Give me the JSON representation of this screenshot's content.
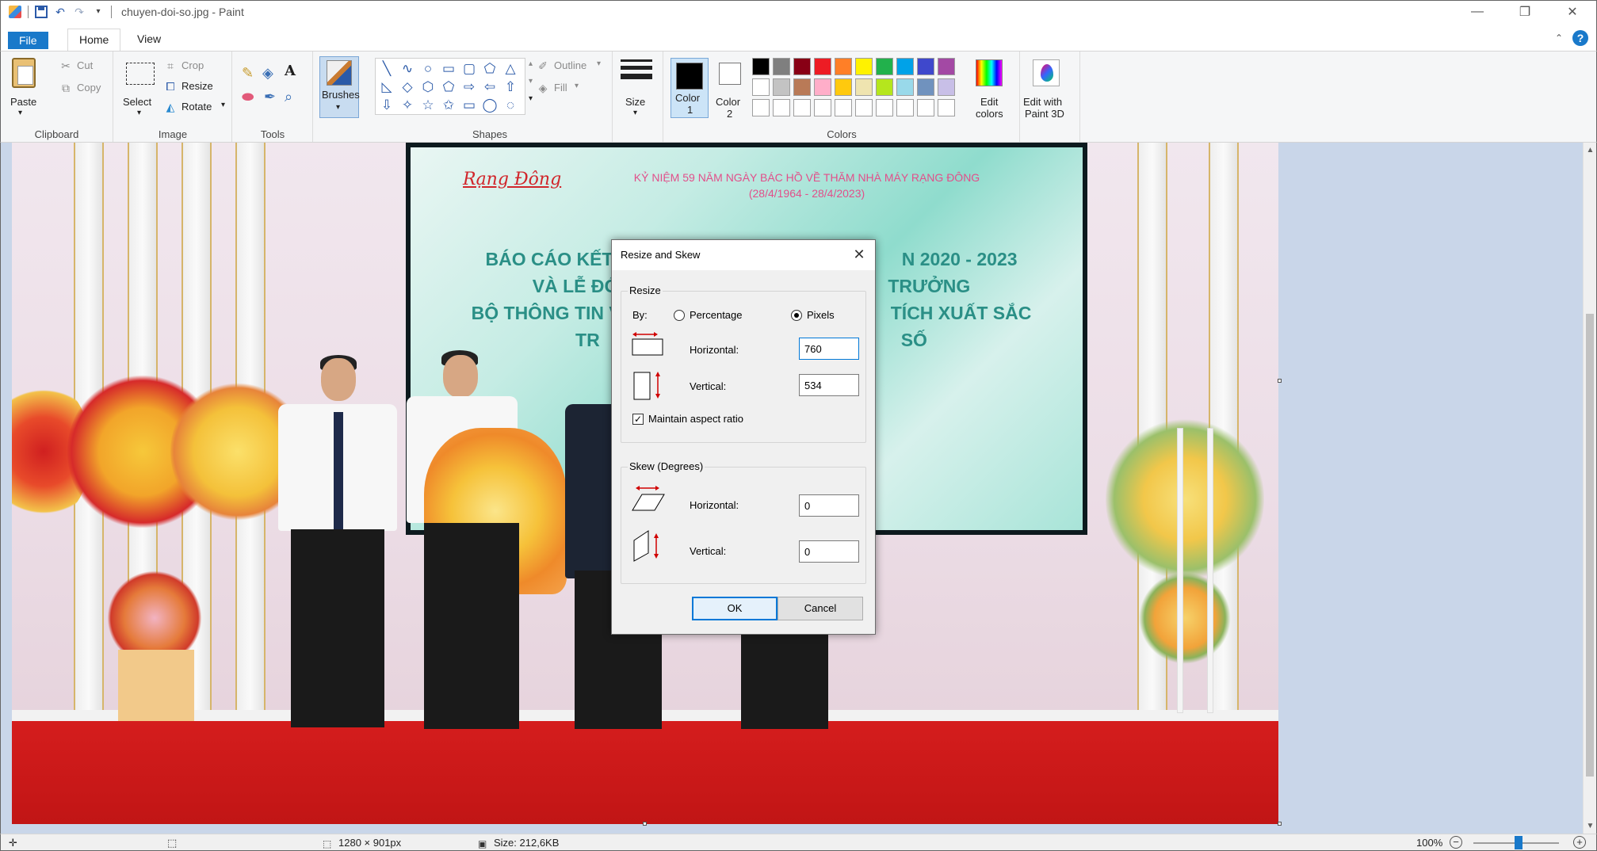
{
  "window": {
    "title": "chuyen-doi-so.jpg - Paint",
    "controls": [
      "minimize",
      "restore",
      "close"
    ]
  },
  "menu": {
    "tabs": [
      {
        "label": "File",
        "active": false
      },
      {
        "label": "Home",
        "active": true
      },
      {
        "label": "View",
        "active": false
      }
    ]
  },
  "ribbon": {
    "clipboard": {
      "paste_label": "Paste",
      "cut_label": "Cut",
      "copy_label": "Copy",
      "group_label": "Clipboard"
    },
    "image": {
      "select_label": "Select",
      "crop_label": "Crop",
      "resize_label": "Resize",
      "rotate_label": "Rotate",
      "group_label": "Image"
    },
    "tools": {
      "group_label": "Tools"
    },
    "brushes": {
      "label": "Brushes"
    },
    "shapes": {
      "outline_label": "Outline",
      "fill_label": "Fill",
      "group_label": "Shapes",
      "glyphs": [
        "╲",
        "∿",
        "○",
        "▭",
        "▢",
        "⬠",
        "△",
        "◺",
        "◇",
        "⬡",
        "⬠",
        "⇨",
        "⇦",
        "⇧",
        "⇩",
        "✧",
        "☆",
        "✩",
        "▭",
        "◯",
        "◌"
      ]
    },
    "size": {
      "label": "Size"
    },
    "colors": {
      "color1_label_line1": "Color",
      "color1_label_line2": "1",
      "color2_label_line1": "Color",
      "color2_label_line2": "2",
      "color1": "#000000",
      "color2": "#ffffff",
      "palette": [
        "#000000",
        "#7f7f7f",
        "#880015",
        "#ed1c24",
        "#ff7f27",
        "#fff200",
        "#22b14c",
        "#00a2e8",
        "#3f48cc",
        "#a349a4",
        "#ffffff",
        "#c3c3c3",
        "#b97a57",
        "#ffaec9",
        "#ffc90e",
        "#efe4b0",
        "#b5e61d",
        "#99d9ea",
        "#7092be",
        "#c8bfe7"
      ],
      "edit_label_line1": "Edit",
      "edit_label_line2": "colors",
      "group_label": "Colors"
    },
    "paint3d": {
      "label_line1": "Edit with",
      "label_line2": "Paint 3D"
    }
  },
  "canvas": {
    "screen_logo": "Rạng Đông",
    "screen_header_line1": "KỶ NIỆM 59 NĂM NGÀY BÁC HỒ VỀ THĂM NHÀ MÁY RẠNG ĐÔNG",
    "screen_header_line2": "(28/4/1964 - 28/4/2023)",
    "screen_line1_left": "BÁO CÁO KẾT Q",
    "screen_line1_right": "N 2020 - 2023",
    "screen_line2_left": "VÀ LỄ ĐÓ",
    "screen_line2_right": "TRƯỞNG",
    "screen_line3_left": "BỘ THÔNG TIN V",
    "screen_line3_right": "TÍCH XUẤT SẮC",
    "screen_line4_left": "TR",
    "screen_line4_right": "SỐ"
  },
  "dialog": {
    "title": "Resize and Skew",
    "resize_legend": "Resize",
    "by_label": "By:",
    "percentage_label": "Percentage",
    "pixels_label": "Pixels",
    "selected_unit": "Pixels",
    "horizontal_label": "Horizontal:",
    "horizontal_value": "760",
    "vertical_label": "Vertical:",
    "vertical_value": "534",
    "maintain_label": "Maintain aspect ratio",
    "maintain_checked": true,
    "skew_legend": "Skew (Degrees)",
    "skew_horizontal_label": "Horizontal:",
    "skew_horizontal_value": "0",
    "skew_vertical_label": "Vertical:",
    "skew_vertical_value": "0",
    "ok_label": "OK",
    "cancel_label": "Cancel"
  },
  "status": {
    "dimensions": "1280 × 901px",
    "size": "Size: 212,6KB",
    "zoom": "100%",
    "zoom_level_percent": 100
  },
  "accent": "#1979ca"
}
